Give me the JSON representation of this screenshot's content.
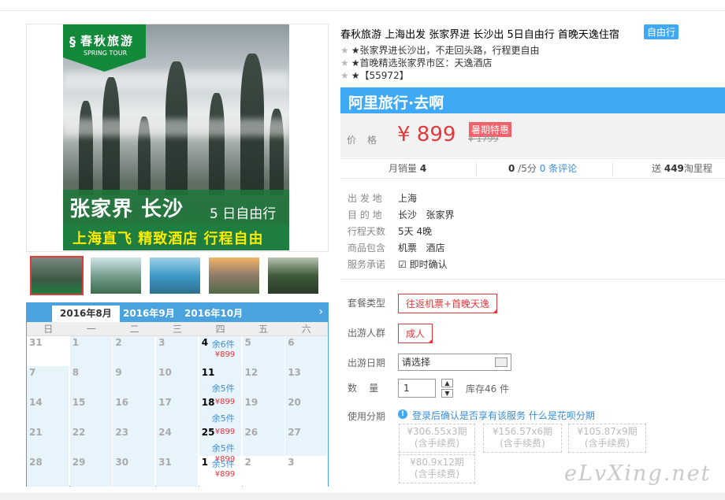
{
  "main_image": {
    "logo_cn": "春秋旅游",
    "logo_en": "SPRING TOUR",
    "banner_title": "张家界 长沙",
    "banner_sub": "5 日自由行",
    "banner_slogan": "上海直飞 精致酒店 行程自由"
  },
  "calendar": {
    "tabs": [
      "2016年8月",
      "2016年9月",
      "2016年10月"
    ],
    "next_icon": "chevron-right-icon",
    "weekdays": [
      "日",
      "一",
      "二",
      "三",
      "四",
      "五",
      "六"
    ],
    "rows": [
      [
        {
          "d": "31"
        },
        {
          "d": "1"
        },
        {
          "d": "2"
        },
        {
          "d": "3"
        },
        {
          "d": "4",
          "stock": "余6件",
          "price": "¥899"
        },
        {
          "d": "5"
        },
        {
          "d": "6"
        }
      ],
      [
        {
          "d": "7"
        },
        {
          "d": "8"
        },
        {
          "d": "9"
        },
        {
          "d": "10"
        },
        {
          "d": "11",
          "stock": "余5件"
        },
        {
          "d": "12"
        },
        {
          "d": "13"
        }
      ],
      [
        {
          "d": "14"
        },
        {
          "d": "15"
        },
        {
          "d": "16"
        },
        {
          "d": "17"
        },
        {
          "d": "18",
          "price": "¥899",
          "stock": "余5件"
        },
        {
          "d": "19"
        },
        {
          "d": "20"
        }
      ],
      [
        {
          "d": "21"
        },
        {
          "d": "22"
        },
        {
          "d": "23"
        },
        {
          "d": "24"
        },
        {
          "d": "25",
          "price": "¥899",
          "stock": "余5件"
        },
        {
          "d": "26"
        },
        {
          "d": "27"
        }
      ],
      [
        {
          "d": "28"
        },
        {
          "d": "29"
        },
        {
          "d": "30"
        },
        {
          "d": "31"
        },
        {
          "d": "1",
          "stock": "余5件",
          "price": "¥899",
          "price_top": "¥899"
        },
        {
          "d": "2"
        },
        {
          "d": "3"
        }
      ]
    ]
  },
  "product": {
    "title": "春秋旅游 上海出发 张家界进 长沙出 5日自由行 首晚天逸住宿",
    "tag": "自由行",
    "features": [
      "★张家界进长沙出，不走回头路，行程更自由",
      "★首晚精选张家界市区：天逸酒店",
      "★【55972】"
    ]
  },
  "seller_bar": "阿里旅行·去啊",
  "price": {
    "label": "价格",
    "value": "¥ 899",
    "promo": "暑期特惠",
    "original": "¥ 1799"
  },
  "stats": {
    "monthly_label": "月销量",
    "monthly_value": "4",
    "score": "0",
    "score_suffix": "/5分",
    "reviews": "0 条评论",
    "points_prefix": "送",
    "points_value": "449",
    "points_suffix": "淘里程"
  },
  "info": [
    {
      "label": "出 发 地",
      "value": "上海"
    },
    {
      "label": "目 的 地",
      "value": "长沙   张家界"
    },
    {
      "label": "行程天数",
      "value": "5天 4晚"
    },
    {
      "label": "商品包含",
      "value": "机票   酒店"
    },
    {
      "label": "服务承诺",
      "value": "即时确认"
    }
  ],
  "options": {
    "package_label": "套餐类型",
    "package_value": "往返机票+首晚天逸",
    "group_label": "出游人群",
    "group_value": "成人",
    "date_label": "出游日期",
    "date_placeholder": "请选择",
    "qty_label": "数    量",
    "qty_value": "1",
    "stock": "库存46 件",
    "installment_label": "使用分期",
    "installment_login": "登录后确认是否享有该服务",
    "installment_link": "什么是花呗分期",
    "plans": [
      {
        "line1": "¥306.55x3期",
        "line2": "(含手续费)"
      },
      {
        "line1": "¥156.57x6期",
        "line2": "(含手续费)"
      },
      {
        "line1": "¥105.87x9期",
        "line2": "(含手续费)"
      },
      {
        "line1": "¥80.9x12期",
        "line2": "(含手续费)"
      }
    ]
  },
  "watermark": "eLvXing.net"
}
